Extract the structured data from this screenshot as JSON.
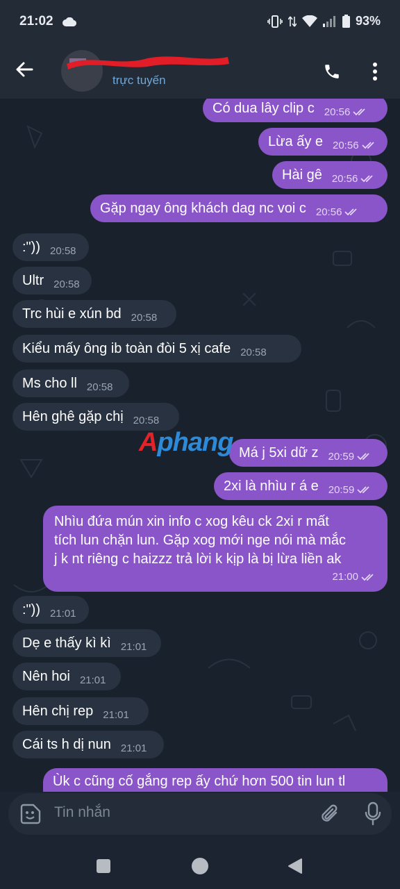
{
  "status_bar": {
    "time": "21:02",
    "battery": "93%"
  },
  "header": {
    "contact_status": "trực tuyến"
  },
  "messages": [
    {
      "dir": "out",
      "text": "Có dua lây clip c",
      "time": "20:56"
    },
    {
      "dir": "out",
      "text": "Lừa ấy e",
      "time": "20:56"
    },
    {
      "dir": "out",
      "text": "Hài gê",
      "time": "20:56"
    },
    {
      "dir": "out",
      "text": "Gặp ngay ông khách dag nc voi c",
      "time": "20:56"
    },
    {
      "dir": "in",
      "text": ":\"))",
      "time": "20:58"
    },
    {
      "dir": "in",
      "text": "Ultr",
      "time": "20:58"
    },
    {
      "dir": "in",
      "text": "Trc hùi e xún bd",
      "time": "20:58"
    },
    {
      "dir": "in",
      "text": "Kiểu mấy ông ib toàn đòi 5 xị cafe",
      "time": "20:58"
    },
    {
      "dir": "in",
      "text": "Ms cho ll",
      "time": "20:58"
    },
    {
      "dir": "in",
      "text": "Hên ghê gặp chị",
      "time": "20:58"
    },
    {
      "dir": "out",
      "text": "Má j 5xi dữ z",
      "time": "20:59"
    },
    {
      "dir": "out",
      "text": "2xi là nhìu r á e",
      "time": "20:59"
    },
    {
      "dir": "out",
      "lines": [
        "Nhìu đứa mún xin info c xog kêu ck 2xi r mất",
        "tích lun chặn lun. Gặp xog mới nge nói mà mắc",
        "j k nt riêng c haizzz trả lời k kịp là bị lừa liền ak"
      ],
      "time": "21:00"
    },
    {
      "dir": "in",
      "text": ":\"))",
      "time": "21:01"
    },
    {
      "dir": "in",
      "text": "Dẹ e thấy kì kì",
      "time": "21:01"
    },
    {
      "dir": "in",
      "text": "Nên hoi",
      "time": "21:01"
    },
    {
      "dir": "in",
      "text": "Hên chị rep",
      "time": "21:01"
    },
    {
      "dir": "in",
      "text": "Cái ts h dị nun",
      "time": "21:01"
    },
    {
      "dir": "out",
      "text": "Ùk c cũng cố gắng rep ấy chứ hơn 500 tin lun tl"
    }
  ],
  "watermark": {
    "first": "A",
    "rest": "phang"
  },
  "composer": {
    "placeholder": "Tin nhắn"
  },
  "colors": {
    "outgoing_bubble": "#8a55c9",
    "incoming_bubble": "#283240",
    "background": "#19212c",
    "online_status": "#71a8d8"
  }
}
